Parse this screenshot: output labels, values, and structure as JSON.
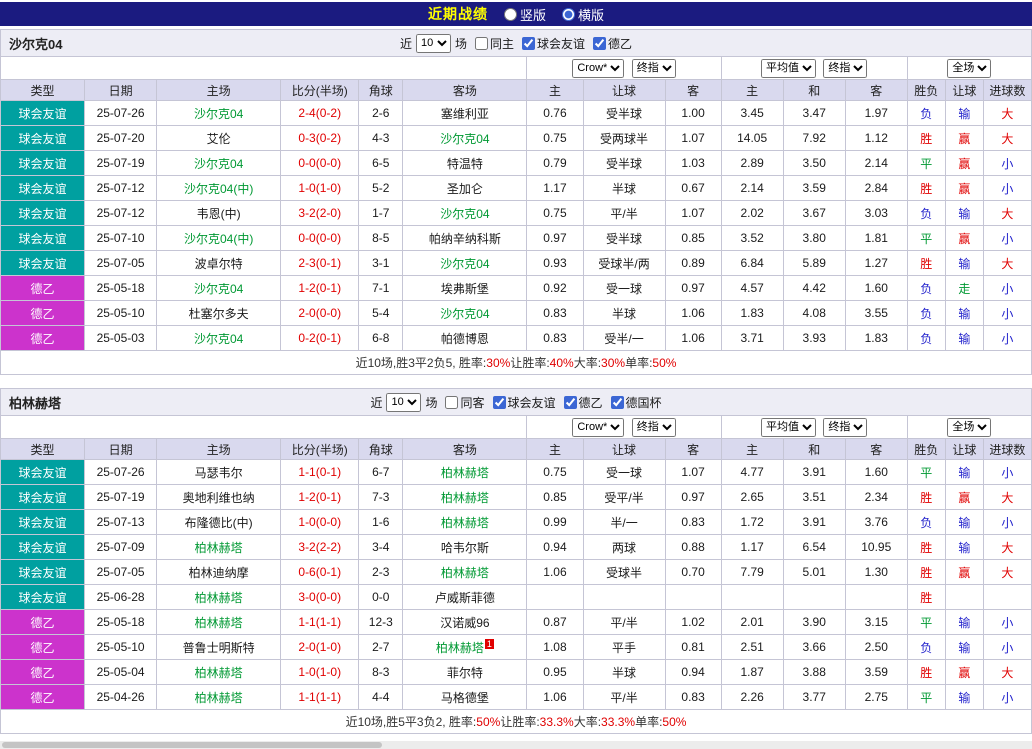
{
  "topbar": {
    "title": "近期战绩",
    "option_vertical": "竖版",
    "option_horizontal": "横版"
  },
  "filter_bar": {
    "bookmaker": "Crow*",
    "final_index": "终指",
    "average": "平均值",
    "full_match": "全场"
  },
  "columns": [
    "类型",
    "日期",
    "主场",
    "比分(半场)",
    "角球",
    "客场",
    "主",
    "让球",
    "客",
    "主",
    "和",
    "客",
    "胜负",
    "让球",
    "进球数"
  ],
  "colors": {
    "topbar_navy": "#1b1b80",
    "title_yellow": "#ffff00",
    "friendly_teal": "#00a0a0",
    "de2_magenta": "#cc33cc",
    "team_green": "#009933",
    "win_red": "#e00000",
    "lose_blue": "#2222cc",
    "header_lavender": "#d9d9ee"
  },
  "sections": [
    {
      "team": "沙尔克04",
      "controls": {
        "near": "近",
        "count": "10",
        "games": "场",
        "checks": [
          {
            "label": "同主",
            "checked": false
          },
          {
            "label": "球会友谊",
            "checked": true
          },
          {
            "label": "德乙",
            "checked": true
          }
        ]
      },
      "rows": [
        {
          "type": "球会友谊",
          "league": "friendly",
          "date": "25-07-26",
          "home": "沙尔克04",
          "home_hl": true,
          "score": "2-4(0-2)",
          "corner": "2-6",
          "away": "塞维利亚",
          "away_hl": false,
          "oh": "0.76",
          "line": "受半球",
          "oa": "1.00",
          "eh": "3.45",
          "ed": "3.47",
          "ea": "1.97",
          "res": "负",
          "resc": "blue",
          "hres": "输",
          "hresc": "blue",
          "goals": "大",
          "goalsc": "red"
        },
        {
          "type": "球会友谊",
          "league": "friendly",
          "date": "25-07-20",
          "home": "艾伦",
          "home_hl": false,
          "score": "0-3(0-2)",
          "corner": "4-3",
          "away": "沙尔克04",
          "away_hl": true,
          "oh": "0.75",
          "line": "受两球半",
          "oa": "1.07",
          "eh": "14.05",
          "ed": "7.92",
          "ea": "1.12",
          "res": "胜",
          "resc": "red",
          "hres": "赢",
          "hresc": "red",
          "goals": "大",
          "goalsc": "red"
        },
        {
          "type": "球会友谊",
          "league": "friendly",
          "date": "25-07-19",
          "home": "沙尔克04",
          "home_hl": true,
          "score": "0-0(0-0)",
          "corner": "6-5",
          "away": "特温特",
          "away_hl": false,
          "oh": "0.79",
          "line": "受半球",
          "oa": "1.03",
          "eh": "2.89",
          "ed": "3.50",
          "ea": "2.14",
          "res": "平",
          "resc": "green",
          "hres": "赢",
          "hresc": "red",
          "goals": "小",
          "goalsc": "blue"
        },
        {
          "type": "球会友谊",
          "league": "friendly",
          "date": "25-07-12",
          "home": "沙尔克04(中)",
          "home_hl": true,
          "score": "1-0(1-0)",
          "corner": "5-2",
          "away": "圣加仑",
          "away_hl": false,
          "oh": "1.17",
          "line": "半球",
          "oa": "0.67",
          "eh": "2.14",
          "ed": "3.59",
          "ea": "2.84",
          "res": "胜",
          "resc": "red",
          "hres": "赢",
          "hresc": "red",
          "goals": "小",
          "goalsc": "blue"
        },
        {
          "type": "球会友谊",
          "league": "friendly",
          "date": "25-07-12",
          "home": "韦恩(中)",
          "home_hl": false,
          "score": "3-2(2-0)",
          "corner": "1-7",
          "away": "沙尔克04",
          "away_hl": true,
          "oh": "0.75",
          "line": "平/半",
          "oa": "1.07",
          "eh": "2.02",
          "ed": "3.67",
          "ea": "3.03",
          "res": "负",
          "resc": "blue",
          "hres": "输",
          "hresc": "blue",
          "goals": "大",
          "goalsc": "red"
        },
        {
          "type": "球会友谊",
          "league": "friendly",
          "date": "25-07-10",
          "home": "沙尔克04(中)",
          "home_hl": true,
          "score": "0-0(0-0)",
          "corner": "8-5",
          "away": "帕纳辛纳科斯",
          "away_hl": false,
          "oh": "0.97",
          "line": "受半球",
          "oa": "0.85",
          "eh": "3.52",
          "ed": "3.80",
          "ea": "1.81",
          "res": "平",
          "resc": "green",
          "hres": "赢",
          "hresc": "red",
          "goals": "小",
          "goalsc": "blue"
        },
        {
          "type": "球会友谊",
          "league": "friendly",
          "date": "25-07-05",
          "home": "波卓尔特",
          "home_hl": false,
          "score": "2-3(0-1)",
          "corner": "3-1",
          "away": "沙尔克04",
          "away_hl": true,
          "oh": "0.93",
          "line": "受球半/两",
          "oa": "0.89",
          "eh": "6.84",
          "ed": "5.89",
          "ea": "1.27",
          "res": "胜",
          "resc": "red",
          "hres": "输",
          "hresc": "blue",
          "goals": "大",
          "goalsc": "red"
        },
        {
          "type": "德乙",
          "league": "de2",
          "date": "25-05-18",
          "home": "沙尔克04",
          "home_hl": true,
          "score": "1-2(0-1)",
          "corner": "7-1",
          "away": "埃弗斯堡",
          "away_hl": false,
          "oh": "0.92",
          "line": "受一球",
          "oa": "0.97",
          "eh": "4.57",
          "ed": "4.42",
          "ea": "1.60",
          "res": "负",
          "resc": "blue",
          "hres": "走",
          "hresc": "green",
          "goals": "小",
          "goalsc": "blue"
        },
        {
          "type": "德乙",
          "league": "de2",
          "date": "25-05-10",
          "home": "杜塞尔多夫",
          "home_hl": false,
          "score": "2-0(0-0)",
          "corner": "5-4",
          "away": "沙尔克04",
          "away_hl": true,
          "oh": "0.83",
          "line": "半球",
          "oa": "1.06",
          "eh": "1.83",
          "ed": "4.08",
          "ea": "3.55",
          "res": "负",
          "resc": "blue",
          "hres": "输",
          "hresc": "blue",
          "goals": "小",
          "goalsc": "blue"
        },
        {
          "type": "德乙",
          "league": "de2",
          "date": "25-05-03",
          "home": "沙尔克04",
          "home_hl": true,
          "score": "0-2(0-1)",
          "corner": "6-8",
          "away": "帕德博恩",
          "away_hl": false,
          "oh": "0.83",
          "line": "受半/一",
          "oa": "1.06",
          "eh": "3.71",
          "ed": "3.93",
          "ea": "1.83",
          "res": "负",
          "resc": "blue",
          "hres": "输",
          "hresc": "blue",
          "goals": "小",
          "goalsc": "blue"
        }
      ],
      "summary_parts": [
        "近10场,胜3平2负5, 胜率:",
        "30%",
        " 让胜率:",
        "40%",
        " 大率:",
        "30%",
        " 单率:",
        "50%"
      ]
    },
    {
      "team": "柏林赫塔",
      "controls": {
        "near": "近",
        "count": "10",
        "games": "场",
        "checks": [
          {
            "label": "同客",
            "checked": false
          },
          {
            "label": "球会友谊",
            "checked": true
          },
          {
            "label": "德乙",
            "checked": true
          },
          {
            "label": "德国杯",
            "checked": true
          }
        ]
      },
      "rows": [
        {
          "type": "球会友谊",
          "league": "friendly",
          "date": "25-07-26",
          "home": "马瑟韦尔",
          "home_hl": false,
          "score": "1-1(0-1)",
          "corner": "6-7",
          "away": "柏林赫塔",
          "away_hl": true,
          "oh": "0.75",
          "line": "受一球",
          "oa": "1.07",
          "eh": "4.77",
          "ed": "3.91",
          "ea": "1.60",
          "res": "平",
          "resc": "green",
          "hres": "输",
          "hresc": "blue",
          "goals": "小",
          "goalsc": "blue"
        },
        {
          "type": "球会友谊",
          "league": "friendly",
          "date": "25-07-19",
          "home": "奥地利维也纳",
          "home_hl": false,
          "score": "1-2(0-1)",
          "corner": "7-3",
          "away": "柏林赫塔",
          "away_hl": true,
          "oh": "0.85",
          "line": "受平/半",
          "oa": "0.97",
          "eh": "2.65",
          "ed": "3.51",
          "ea": "2.34",
          "res": "胜",
          "resc": "red",
          "hres": "赢",
          "hresc": "red",
          "goals": "大",
          "goalsc": "red"
        },
        {
          "type": "球会友谊",
          "league": "friendly",
          "date": "25-07-13",
          "home": "布隆德比(中)",
          "home_hl": false,
          "score": "1-0(0-0)",
          "corner": "1-6",
          "away": "柏林赫塔",
          "away_hl": true,
          "oh": "0.99",
          "line": "半/一",
          "oa": "0.83",
          "eh": "1.72",
          "ed": "3.91",
          "ea": "3.76",
          "res": "负",
          "resc": "blue",
          "hres": "输",
          "hresc": "blue",
          "goals": "小",
          "goalsc": "blue"
        },
        {
          "type": "球会友谊",
          "league": "friendly",
          "date": "25-07-09",
          "home": "柏林赫塔",
          "home_hl": true,
          "score": "3-2(2-2)",
          "corner": "3-4",
          "away": "哈韦尔斯",
          "away_hl": false,
          "oh": "0.94",
          "line": "两球",
          "oa": "0.88",
          "eh": "1.17",
          "ed": "6.54",
          "ea": "10.95",
          "res": "胜",
          "resc": "red",
          "hres": "输",
          "hresc": "blue",
          "goals": "大",
          "goalsc": "red"
        },
        {
          "type": "球会友谊",
          "league": "friendly",
          "date": "25-07-05",
          "home": "柏林迪纳摩",
          "home_hl": false,
          "score": "0-6(0-1)",
          "corner": "2-3",
          "away": "柏林赫塔",
          "away_hl": true,
          "oh": "1.06",
          "line": "受球半",
          "oa": "0.70",
          "eh": "7.79",
          "ed": "5.01",
          "ea": "1.30",
          "res": "胜",
          "resc": "red",
          "hres": "赢",
          "hresc": "red",
          "goals": "大",
          "goalsc": "red"
        },
        {
          "type": "球会友谊",
          "league": "friendly",
          "date": "25-06-28",
          "home": "柏林赫塔",
          "home_hl": true,
          "score": "3-0(0-0)",
          "corner": "0-0",
          "away": "卢威斯菲德",
          "away_hl": false,
          "oh": "",
          "line": "",
          "oa": "",
          "eh": "",
          "ed": "",
          "ea": "",
          "res": "胜",
          "resc": "red",
          "hres": "",
          "hresc": "",
          "goals": "",
          "goalsc": ""
        },
        {
          "type": "德乙",
          "league": "de2",
          "date": "25-05-18",
          "home": "柏林赫塔",
          "home_hl": true,
          "score": "1-1(1-1)",
          "corner": "12-3",
          "away": "汉诺威96",
          "away_hl": false,
          "oh": "0.87",
          "line": "平/半",
          "oa": "1.02",
          "eh": "2.01",
          "ed": "3.90",
          "ea": "3.15",
          "res": "平",
          "resc": "green",
          "hres": "输",
          "hresc": "blue",
          "goals": "小",
          "goalsc": "blue"
        },
        {
          "type": "德乙",
          "league": "de2",
          "date": "25-05-10",
          "home": "普鲁士明斯特",
          "home_hl": false,
          "score": "2-0(1-0)",
          "corner": "2-7",
          "away": "柏林赫塔",
          "away_hl": true,
          "away_badge": "1",
          "oh": "1.08",
          "line": "平手",
          "oa": "0.81",
          "eh": "2.51",
          "ed": "3.66",
          "ea": "2.50",
          "res": "负",
          "resc": "blue",
          "hres": "输",
          "hresc": "blue",
          "goals": "小",
          "goalsc": "blue"
        },
        {
          "type": "德乙",
          "league": "de2",
          "date": "25-05-04",
          "home": "柏林赫塔",
          "home_hl": true,
          "score": "1-0(1-0)",
          "corner": "8-3",
          "away": "菲尔特",
          "away_hl": false,
          "oh": "0.95",
          "line": "半球",
          "oa": "0.94",
          "eh": "1.87",
          "ed": "3.88",
          "ea": "3.59",
          "res": "胜",
          "resc": "red",
          "hres": "赢",
          "hresc": "red",
          "goals": "大",
          "goalsc": "red"
        },
        {
          "type": "德乙",
          "league": "de2",
          "date": "25-04-26",
          "home": "柏林赫塔",
          "home_hl": true,
          "score": "1-1(1-1)",
          "corner": "4-4",
          "away": "马格德堡",
          "away_hl": false,
          "oh": "1.06",
          "line": "平/半",
          "oa": "0.83",
          "eh": "2.26",
          "ed": "3.77",
          "ea": "2.75",
          "res": "平",
          "resc": "green",
          "hres": "输",
          "hresc": "blue",
          "goals": "小",
          "goalsc": "blue"
        }
      ],
      "summary_parts": [
        "近10场,胜5平3负2, 胜率:",
        "50%",
        " 让胜率:",
        "33.3%",
        " 大率:",
        "33.3%",
        " 单率:",
        "50%"
      ]
    }
  ]
}
